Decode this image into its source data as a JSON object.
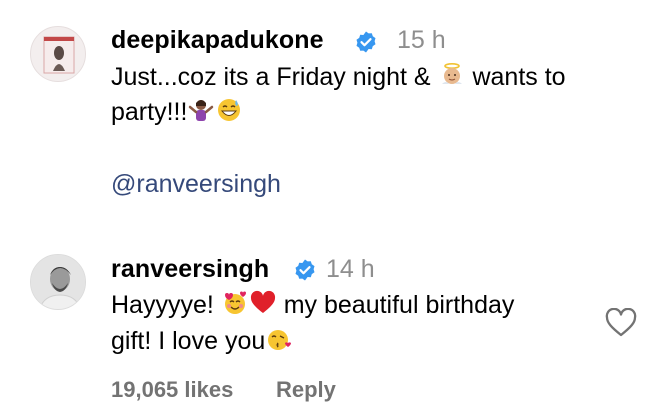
{
  "comments": [
    {
      "username": "deepikapadukone",
      "timestamp": "15 h",
      "line1_a": "Just...coz its a Friday night & ",
      "line1_b": " wants to",
      "line2": "party!!!",
      "mention": "@ranveersingh"
    },
    {
      "username": "ranveersingh",
      "timestamp": "14 h",
      "line1_a": "Hayyyye! ",
      "line1_b": " my beautiful birthday",
      "line2": "gift! I love you",
      "likes": "19,065 likes",
      "reply": "Reply"
    }
  ],
  "icons": {
    "verified": "verified-badge-icon",
    "like": "heart-outline-icon",
    "emojis": [
      "baby-angel-emoji",
      "woman-shrugging-emoji",
      "grinning-sweat-emoji",
      "smiling-hearts-emoji",
      "red-heart-emoji",
      "kissing-face-emoji"
    ]
  },
  "colors": {
    "verified": "#3797f0",
    "mention": "#35497a",
    "secondary_text": "#8e8e8e"
  }
}
